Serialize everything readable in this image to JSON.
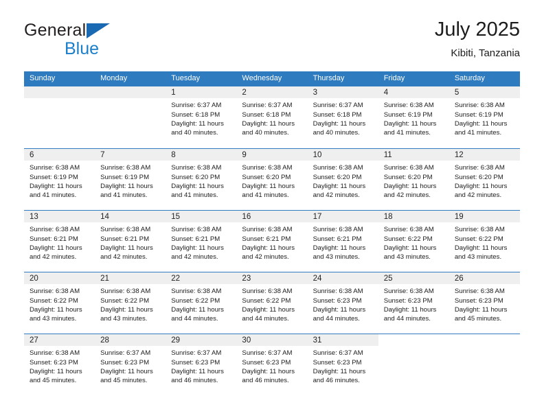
{
  "brand": {
    "word_one": "General",
    "word_two": "Blue",
    "triangle_icon": "triangle-icon",
    "accent": "#1a7ec9"
  },
  "header": {
    "title": "July 2025",
    "subtitle": "Kibiti, Tanzania"
  },
  "colors": {
    "header_blue": "#2f7bbf",
    "daynum_band": "#efefef",
    "rule_blue": "#2f7bbf"
  },
  "weekdays": [
    "Sunday",
    "Monday",
    "Tuesday",
    "Wednesday",
    "Thursday",
    "Friday",
    "Saturday"
  ],
  "weeks": [
    [
      {
        "day": "",
        "sunrise": "",
        "sunset": "",
        "daylight_1": "",
        "daylight_2": ""
      },
      {
        "day": "",
        "sunrise": "",
        "sunset": "",
        "daylight_1": "",
        "daylight_2": ""
      },
      {
        "day": "1",
        "sunrise": "Sunrise: 6:37 AM",
        "sunset": "Sunset: 6:18 PM",
        "daylight_1": "Daylight: 11 hours",
        "daylight_2": "and 40 minutes."
      },
      {
        "day": "2",
        "sunrise": "Sunrise: 6:37 AM",
        "sunset": "Sunset: 6:18 PM",
        "daylight_1": "Daylight: 11 hours",
        "daylight_2": "and 40 minutes."
      },
      {
        "day": "3",
        "sunrise": "Sunrise: 6:37 AM",
        "sunset": "Sunset: 6:18 PM",
        "daylight_1": "Daylight: 11 hours",
        "daylight_2": "and 40 minutes."
      },
      {
        "day": "4",
        "sunrise": "Sunrise: 6:38 AM",
        "sunset": "Sunset: 6:19 PM",
        "daylight_1": "Daylight: 11 hours",
        "daylight_2": "and 41 minutes."
      },
      {
        "day": "5",
        "sunrise": "Sunrise: 6:38 AM",
        "sunset": "Sunset: 6:19 PM",
        "daylight_1": "Daylight: 11 hours",
        "daylight_2": "and 41 minutes."
      }
    ],
    [
      {
        "day": "6",
        "sunrise": "Sunrise: 6:38 AM",
        "sunset": "Sunset: 6:19 PM",
        "daylight_1": "Daylight: 11 hours",
        "daylight_2": "and 41 minutes."
      },
      {
        "day": "7",
        "sunrise": "Sunrise: 6:38 AM",
        "sunset": "Sunset: 6:19 PM",
        "daylight_1": "Daylight: 11 hours",
        "daylight_2": "and 41 minutes."
      },
      {
        "day": "8",
        "sunrise": "Sunrise: 6:38 AM",
        "sunset": "Sunset: 6:20 PM",
        "daylight_1": "Daylight: 11 hours",
        "daylight_2": "and 41 minutes."
      },
      {
        "day": "9",
        "sunrise": "Sunrise: 6:38 AM",
        "sunset": "Sunset: 6:20 PM",
        "daylight_1": "Daylight: 11 hours",
        "daylight_2": "and 41 minutes."
      },
      {
        "day": "10",
        "sunrise": "Sunrise: 6:38 AM",
        "sunset": "Sunset: 6:20 PM",
        "daylight_1": "Daylight: 11 hours",
        "daylight_2": "and 42 minutes."
      },
      {
        "day": "11",
        "sunrise": "Sunrise: 6:38 AM",
        "sunset": "Sunset: 6:20 PM",
        "daylight_1": "Daylight: 11 hours",
        "daylight_2": "and 42 minutes."
      },
      {
        "day": "12",
        "sunrise": "Sunrise: 6:38 AM",
        "sunset": "Sunset: 6:20 PM",
        "daylight_1": "Daylight: 11 hours",
        "daylight_2": "and 42 minutes."
      }
    ],
    [
      {
        "day": "13",
        "sunrise": "Sunrise: 6:38 AM",
        "sunset": "Sunset: 6:21 PM",
        "daylight_1": "Daylight: 11 hours",
        "daylight_2": "and 42 minutes."
      },
      {
        "day": "14",
        "sunrise": "Sunrise: 6:38 AM",
        "sunset": "Sunset: 6:21 PM",
        "daylight_1": "Daylight: 11 hours",
        "daylight_2": "and 42 minutes."
      },
      {
        "day": "15",
        "sunrise": "Sunrise: 6:38 AM",
        "sunset": "Sunset: 6:21 PM",
        "daylight_1": "Daylight: 11 hours",
        "daylight_2": "and 42 minutes."
      },
      {
        "day": "16",
        "sunrise": "Sunrise: 6:38 AM",
        "sunset": "Sunset: 6:21 PM",
        "daylight_1": "Daylight: 11 hours",
        "daylight_2": "and 42 minutes."
      },
      {
        "day": "17",
        "sunrise": "Sunrise: 6:38 AM",
        "sunset": "Sunset: 6:21 PM",
        "daylight_1": "Daylight: 11 hours",
        "daylight_2": "and 43 minutes."
      },
      {
        "day": "18",
        "sunrise": "Sunrise: 6:38 AM",
        "sunset": "Sunset: 6:22 PM",
        "daylight_1": "Daylight: 11 hours",
        "daylight_2": "and 43 minutes."
      },
      {
        "day": "19",
        "sunrise": "Sunrise: 6:38 AM",
        "sunset": "Sunset: 6:22 PM",
        "daylight_1": "Daylight: 11 hours",
        "daylight_2": "and 43 minutes."
      }
    ],
    [
      {
        "day": "20",
        "sunrise": "Sunrise: 6:38 AM",
        "sunset": "Sunset: 6:22 PM",
        "daylight_1": "Daylight: 11 hours",
        "daylight_2": "and 43 minutes."
      },
      {
        "day": "21",
        "sunrise": "Sunrise: 6:38 AM",
        "sunset": "Sunset: 6:22 PM",
        "daylight_1": "Daylight: 11 hours",
        "daylight_2": "and 43 minutes."
      },
      {
        "day": "22",
        "sunrise": "Sunrise: 6:38 AM",
        "sunset": "Sunset: 6:22 PM",
        "daylight_1": "Daylight: 11 hours",
        "daylight_2": "and 44 minutes."
      },
      {
        "day": "23",
        "sunrise": "Sunrise: 6:38 AM",
        "sunset": "Sunset: 6:22 PM",
        "daylight_1": "Daylight: 11 hours",
        "daylight_2": "and 44 minutes."
      },
      {
        "day": "24",
        "sunrise": "Sunrise: 6:38 AM",
        "sunset": "Sunset: 6:23 PM",
        "daylight_1": "Daylight: 11 hours",
        "daylight_2": "and 44 minutes."
      },
      {
        "day": "25",
        "sunrise": "Sunrise: 6:38 AM",
        "sunset": "Sunset: 6:23 PM",
        "daylight_1": "Daylight: 11 hours",
        "daylight_2": "and 44 minutes."
      },
      {
        "day": "26",
        "sunrise": "Sunrise: 6:38 AM",
        "sunset": "Sunset: 6:23 PM",
        "daylight_1": "Daylight: 11 hours",
        "daylight_2": "and 45 minutes."
      }
    ],
    [
      {
        "day": "27",
        "sunrise": "Sunrise: 6:38 AM",
        "sunset": "Sunset: 6:23 PM",
        "daylight_1": "Daylight: 11 hours",
        "daylight_2": "and 45 minutes."
      },
      {
        "day": "28",
        "sunrise": "Sunrise: 6:37 AM",
        "sunset": "Sunset: 6:23 PM",
        "daylight_1": "Daylight: 11 hours",
        "daylight_2": "and 45 minutes."
      },
      {
        "day": "29",
        "sunrise": "Sunrise: 6:37 AM",
        "sunset": "Sunset: 6:23 PM",
        "daylight_1": "Daylight: 11 hours",
        "daylight_2": "and 46 minutes."
      },
      {
        "day": "30",
        "sunrise": "Sunrise: 6:37 AM",
        "sunset": "Sunset: 6:23 PM",
        "daylight_1": "Daylight: 11 hours",
        "daylight_2": "and 46 minutes."
      },
      {
        "day": "31",
        "sunrise": "Sunrise: 6:37 AM",
        "sunset": "Sunset: 6:23 PM",
        "daylight_1": "Daylight: 11 hours",
        "daylight_2": "and 46 minutes."
      },
      {
        "day": "",
        "sunrise": "",
        "sunset": "",
        "daylight_1": "",
        "daylight_2": ""
      },
      {
        "day": "",
        "sunrise": "",
        "sunset": "",
        "daylight_1": "",
        "daylight_2": ""
      }
    ]
  ]
}
